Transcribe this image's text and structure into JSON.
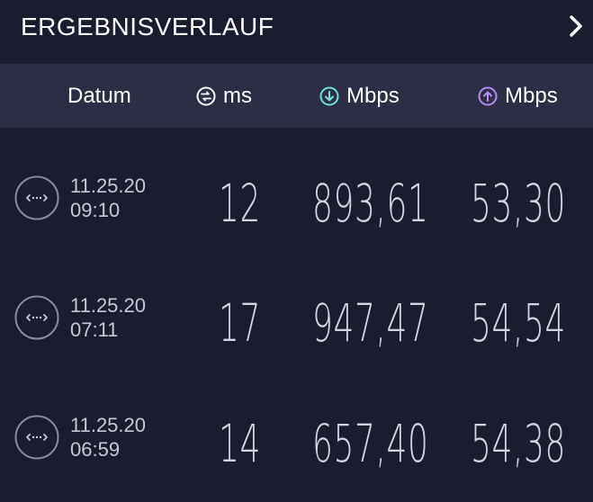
{
  "header": {
    "title": "ERGEBNISVERLAUF"
  },
  "columns": {
    "date_label": "Datum",
    "ping_unit": "ms",
    "download_unit": "Mbps",
    "upload_unit": "Mbps",
    "ping_icon": "ping-icon",
    "download_icon": "download-arrow-icon",
    "upload_icon": "upload-arrow-icon"
  },
  "colors": {
    "background": "#1b1c30",
    "header_band": "#2b2e45",
    "download_accent": "#6ee0d8",
    "upload_accent": "#b58cf0"
  },
  "results": [
    {
      "date": "11.25.20",
      "time": "09:10",
      "ping": "12",
      "download": "893,61",
      "upload": "53,30"
    },
    {
      "date": "11.25.20",
      "time": "07:11",
      "ping": "17",
      "download": "947,47",
      "upload": "54,54"
    },
    {
      "date": "11.25.20",
      "time": "06:59",
      "ping": "14",
      "download": "657,40",
      "upload": "54,38"
    }
  ]
}
